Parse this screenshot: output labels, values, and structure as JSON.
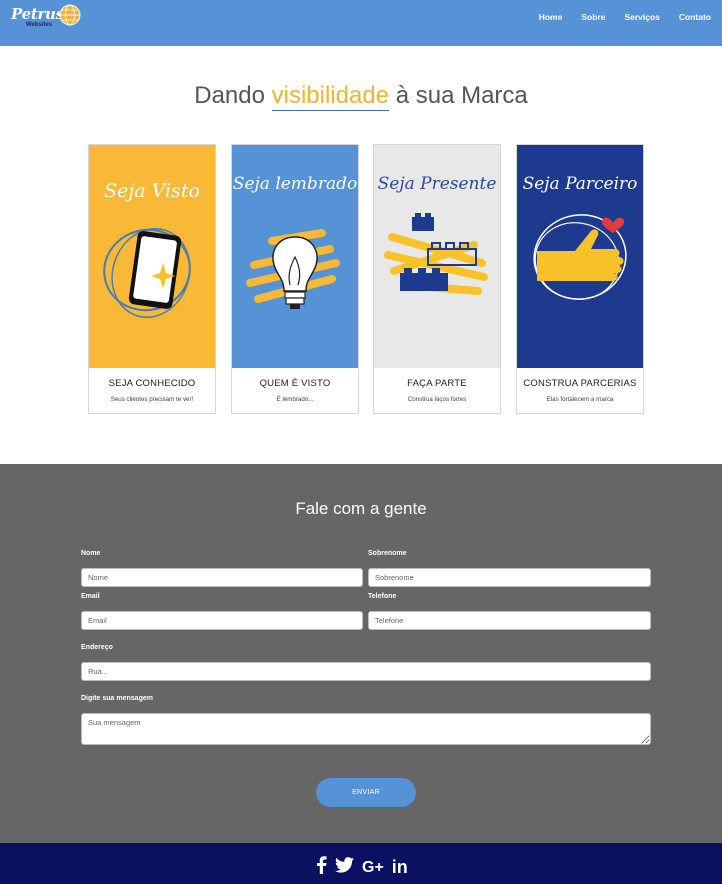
{
  "header": {
    "logo_text": "Petrus",
    "logo_sub": "Websites",
    "nav": [
      "Home",
      "Sobre",
      "Serviços",
      "Contato"
    ]
  },
  "hero": {
    "title_pre": "Dando ",
    "title_accent": "visibilidade",
    "title_post": " à sua Marca"
  },
  "cards": [
    {
      "script": "Seja Visto",
      "title": "SEJA CONHECIDO",
      "subtitle": "Seus clientes precisam te ver!",
      "bg": "#f9b835"
    },
    {
      "script": "Seja lembrado",
      "title": "QUEM É VISTO",
      "subtitle": "É lembrado...",
      "bg": "#5592d6"
    },
    {
      "script": "Seja Presente",
      "title": "FAÇA PARTE",
      "subtitle": "Construa laços fortes",
      "bg": "#e8e8e8"
    },
    {
      "script": "Seja Parceiro",
      "title": "CONSTRUA PARCERIAS",
      "subtitle": "Elas fortalecem a marca",
      "bg": "#1e3a8f"
    }
  ],
  "contact": {
    "title": "Fale com a gente",
    "first_name": {
      "label": "Nome",
      "placeholder": "Nome",
      "value": ""
    },
    "last_name": {
      "label": "Sobrenome",
      "placeholder": "Sobrenome",
      "value": ""
    },
    "email": {
      "label": "Email",
      "placeholder": "Email",
      "value": ""
    },
    "phone": {
      "label": "Telefone",
      "placeholder": "Telefone",
      "value": ""
    },
    "address": {
      "label": "Endereço",
      "placeholder": "Rua...",
      "value": ""
    },
    "message": {
      "label": "Digite sua mensagem",
      "placeholder": "Sua mensagem",
      "value": ""
    },
    "submit": "ENVIAR"
  },
  "footer": {
    "social_icons": [
      "facebook-icon",
      "twitter-icon",
      "google-plus-icon",
      "linkedin-icon"
    ],
    "google_plus_text": "G+",
    "linkedin_text": "in"
  },
  "colors": {
    "header": "#5592d6",
    "accent": "#f2b234",
    "contact_bg": "#666666",
    "footer_bg": "#0b1060"
  }
}
